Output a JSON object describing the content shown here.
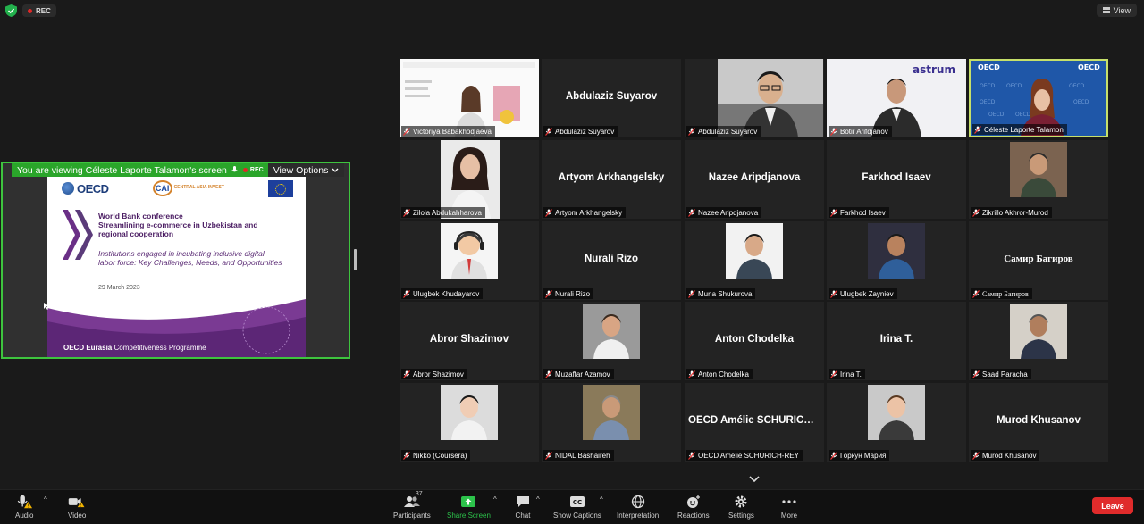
{
  "top": {
    "rec_label": "REC",
    "view_label": "View"
  },
  "share": {
    "viewing_text": "You are viewing Céleste Laporte Talamon's screen",
    "rec_label": "REC",
    "view_options_label": "View Options",
    "slide": {
      "org": "OECD",
      "partner_logo_text": "CENTRAL ASIA INVEST",
      "title_line1": "World Bank conference",
      "title_line2": "Streamlining e-commerce in Uzbekistan and",
      "title_line3": "regional cooperation",
      "subtitle_line1": "Institutions engaged in incubating inclusive digital",
      "subtitle_line2": "labor force: Key Challenges, Needs, and Opportunities",
      "date": "29 March 2023",
      "footer_bold": "OECD Eurasia",
      "footer_rest": " Competitiveness Programme"
    }
  },
  "tiles": [
    {
      "name": "Victoriya Babakhodjaeva",
      "center": "",
      "kind": "photo-slide"
    },
    {
      "name": "Abdulaziz Suyarov",
      "center": "Abdulaziz Suyarov",
      "kind": "name"
    },
    {
      "name": "Abdulaziz Suyarov",
      "center": "",
      "kind": "photo-man-glasses"
    },
    {
      "name": "Botir Arifdjanov",
      "center": "",
      "kind": "photo-astrum",
      "brand": "astrum"
    },
    {
      "name": "Céleste Laporte Talamon",
      "center": "",
      "kind": "photo-oecd",
      "active": true,
      "brand": "OECD"
    },
    {
      "name": "Zilola Abdukahharova",
      "center": "",
      "kind": "photo-small-woman"
    },
    {
      "name": "Artyom Arkhangelsky",
      "center": "Artyom Arkhangelsky",
      "kind": "name"
    },
    {
      "name": "Nazee Aripdjanova",
      "center": "Nazee Aripdjanova",
      "kind": "name"
    },
    {
      "name": "Farkhod Isaev",
      "center": "Farkhod Isaev",
      "kind": "name"
    },
    {
      "name": "Zikrillo Akhror-Murod",
      "center": "",
      "kind": "photo-small-man"
    },
    {
      "name": "Ulugbek Khudayarov",
      "center": "",
      "kind": "photo-avatar"
    },
    {
      "name": "Nurali Rizo",
      "center": "Nurali Rizo",
      "kind": "name"
    },
    {
      "name": "Muna Shukurova",
      "center": "",
      "kind": "photo-small-woman2"
    },
    {
      "name": "Ulugbek Zayniev",
      "center": "",
      "kind": "photo-small-man2"
    },
    {
      "name": "Самир Багиров",
      "center": "Самир Багиров",
      "kind": "name-serif"
    },
    {
      "name": "Abror Shazimov",
      "center": "Abror Shazimov",
      "kind": "name"
    },
    {
      "name": "Muzaffar Azamov",
      "center": "",
      "kind": "photo-small-man3"
    },
    {
      "name": "Anton Chodelka",
      "center": "Anton Chodelka",
      "kind": "name"
    },
    {
      "name": "Irina T.",
      "center": "Irina T.",
      "kind": "name"
    },
    {
      "name": "Saad Paracha",
      "center": "",
      "kind": "photo-small-man4"
    },
    {
      "name": "Nikko (Coursera)",
      "center": "",
      "kind": "photo-small-woman3"
    },
    {
      "name": "NIDAL Bashaireh",
      "center": "",
      "kind": "photo-small-man5"
    },
    {
      "name": "OECD Amélie SCHURICH-REY",
      "center": "OECD Amélie SCHURICH-R...",
      "kind": "name"
    },
    {
      "name": "Горкун Мария",
      "center": "",
      "kind": "photo-small-woman4"
    },
    {
      "name": "Murod Khusanov",
      "center": "Murod Khusanov",
      "kind": "name"
    }
  ],
  "toolbar": {
    "audio": "Audio",
    "video": "Video",
    "participants": "Participants",
    "participants_count": "37",
    "share_screen": "Share Screen",
    "chat": "Chat",
    "show_captions": "Show Captions",
    "interpretation": "Interpretation",
    "reactions": "Reactions",
    "settings": "Settings",
    "more": "More",
    "leave": "Leave"
  }
}
